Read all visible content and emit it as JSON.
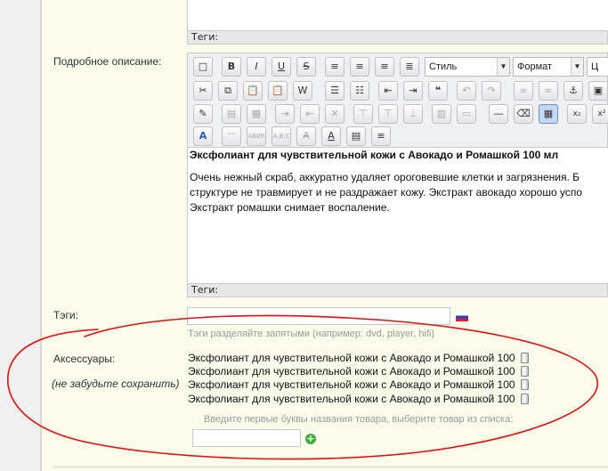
{
  "labels": {
    "detailed_description": "Подробное описание:",
    "tags": "Тэги:",
    "accessories": "Аксессуары:",
    "dont_forget": "(не забудьте сохранить)"
  },
  "editor": {
    "tagbar_label": "Теги:",
    "style_select": "Стиль",
    "format_select": "Формат",
    "size_select_partial": "Ц",
    "heading": "Эксфолиант для чувствительной кожи с Авокадо и Ромашкой 100 мл",
    "paragraph_lines": [
      "Очень нежный скраб, аккуратно удаляет ороговевшие клетки и загрязнения. Б",
      "структуре не травмирует и не раздражает кожу. Экстракт авокадо хорошо успо",
      "Экстракт ромашки снимает воспаление."
    ]
  },
  "tags_field": {
    "value": "",
    "hint": "Тэги разделяйте запятыми (например: dvd, player, hifi)"
  },
  "accessories": {
    "items": [
      "Эксфолиант для чувствительной кожи с Авокадо и Ромашкой 100",
      "Эксфолиант для чувствительной кожи с Авокадо и Ромашкой 100",
      "Эксфолиант для чувствительной кожи с Авокадо и Ромашкой 100",
      "Эксфолиант для чувствительной кожи с Авокадо и Ромашкой 100"
    ],
    "search_hint": "Введите первые буквы названия товара, выберите товар из списка:",
    "search_value": ""
  },
  "colors": {
    "panel_bg": "#fbfbeb",
    "annotation_red": "#e01010",
    "add_green": "#3fae3f"
  }
}
